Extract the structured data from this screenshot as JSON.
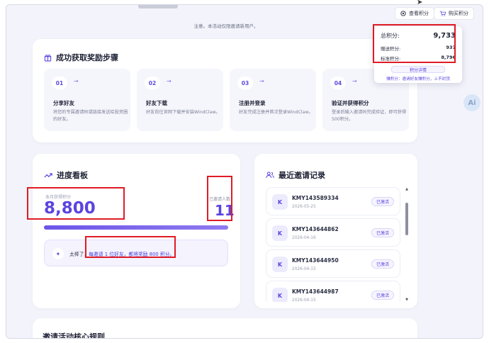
{
  "header": {
    "notice": "注意。本活动仅限邀请新用户。",
    "view_points_label": "查看积分",
    "buy_points_label": "购买积分"
  },
  "points_popover": {
    "total_label": "总积分:",
    "total_value": "9,733",
    "gift_label": "赠送积分:",
    "gift_value": "937",
    "standard_label": "标准积分:",
    "standard_value": "8,796",
    "details_label": "积分详情",
    "note": "赚积分：邀请好友赚积分，上不封顶"
  },
  "steps_section": {
    "title": "成功获取奖励步骤",
    "steps": [
      {
        "num": "01",
        "title": "分享好友",
        "desc": "将您的专属邀请码或链接发送给投资圈的好友。"
      },
      {
        "num": "02",
        "title": "好友下载",
        "desc": "好友前往官网下载并安装WindClaw。"
      },
      {
        "num": "03",
        "title": "注册并登录",
        "desc": "好友完成注册并首次登录WindClaw。"
      },
      {
        "num": "04",
        "title": "验证并获得积分",
        "desc": "登录后输入邀请码完成验证，即可获得500积分。"
      }
    ]
  },
  "progress": {
    "title": "进度看板",
    "total_label": "本月获得积分",
    "total_value": "8,800",
    "people_label": "已邀请人数",
    "people_value": "11",
    "progress_fraction": 1.0,
    "praise_prefix": "太棒了，",
    "praise_highlight": "每邀请 1 位好友，都将奖励 800 积分。"
  },
  "records": {
    "title": "最近邀请记录",
    "items": [
      {
        "avatar": "K",
        "code": "KMY143589334",
        "date": "2026-05-25",
        "status": "已激活"
      },
      {
        "avatar": "K",
        "code": "KMY143644862",
        "date": "2026-04-16",
        "status": "已激活"
      },
      {
        "avatar": "K",
        "code": "KMY143644950",
        "date": "2026-04-15",
        "status": "已激活"
      },
      {
        "avatar": "K",
        "code": "KMY143644987",
        "date": "2026-04-15",
        "status": "已激活"
      }
    ]
  },
  "rules": {
    "title": "邀请活动核心规则"
  },
  "ai_label": "Ai",
  "colors": {
    "accent": "#5a45e0",
    "highlight_box": "#e01b24",
    "background": "#f3f4fb"
  }
}
